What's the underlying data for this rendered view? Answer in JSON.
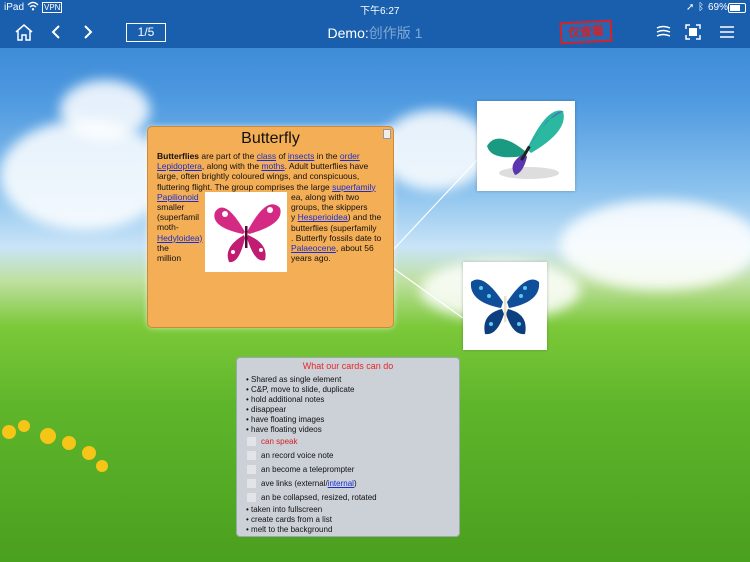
{
  "status_bar": {
    "device": "iPad",
    "vpn": "VPN",
    "time": "下午6:27",
    "battery": "69%"
  },
  "toolbar": {
    "page_indicator": "1/5",
    "title_main": "Demo:",
    "title_sub": "创作版 1",
    "view_only_stamp": "仅查看"
  },
  "butterfly_card": {
    "title": "Butterfly",
    "p_bold": "Butterflies",
    "p1": " are part of the ",
    "link_class": "class",
    "p2": " of ",
    "link_insects": "insects",
    "p3": " in the ",
    "link_order": "order",
    "link_lepidoptera": "Lepidoptera",
    "p4": ", along with the ",
    "link_moths": "moths",
    "p5": ". Adult butterflies have large, often brightly coloured wings, and conspicuous, fluttering flight. The group comprises the large ",
    "link_superfamily": "superfamily",
    "link_papilionoid": "Papilionoid",
    "left_col": [
      "smaller",
      "(superfamil",
      "moth-",
      "Hedyloidea)",
      "the",
      "million"
    ],
    "right_col_1": "ea, along with two",
    "right_col_2": "groups, the skippers",
    "right_col_3_pre": "y ",
    "link_hesperioidea": "Hesperioidea",
    "right_col_3_post": ") and the",
    "right_col_4": "butterflies (superfamily",
    "right_col_5": ". Butterfly fossils date to",
    "link_palaeocene": "Palaeocene",
    "right_col_6": ", about 56",
    "right_col_7": "years ago."
  },
  "list_card": {
    "title": "What our cards can do",
    "bullets_top": [
      "• Shared as single element",
      "• C&P, move to slide, duplicate",
      "• hold additional notes",
      "• disappear",
      "• have floating images",
      "• have floating videos"
    ],
    "checklist": [
      {
        "text": "can speak",
        "red": true
      },
      {
        "text": "an record voice note",
        "red": false
      },
      {
        "text": "an become a teleprompter",
        "red": false
      },
      {
        "text": "ave links (external/",
        "link": "internal",
        "tail": ")",
        "red": false
      },
      {
        "text": "an be collapsed, resized, rotated",
        "red": false
      }
    ],
    "bullets_bottom": [
      "• taken into fullscreen",
      "• create cards from a list",
      "• melt to the background"
    ]
  },
  "colors": {
    "toolbar": "#1a5fae",
    "card_orange": "#f4ae55",
    "list_card": "#ccd0d7",
    "link": "#1a2fd1",
    "red": "#e8262c"
  }
}
